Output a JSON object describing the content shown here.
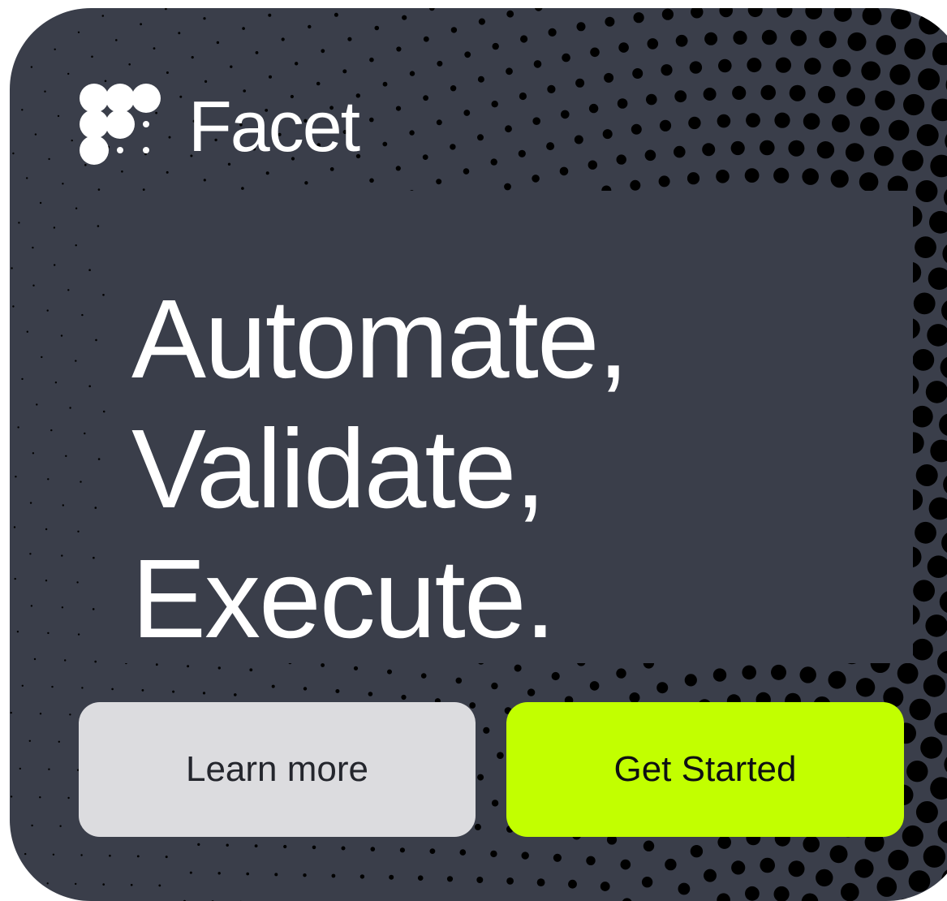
{
  "brand": {
    "name": "Facet",
    "logo_icon": "facet-dots-logo-icon"
  },
  "hero": {
    "lines": [
      "Automate,",
      "Validate,",
      "Execute."
    ]
  },
  "actions": {
    "learn_more": "Learn more",
    "get_started": "Get Started"
  },
  "colors": {
    "background": "#3a3e4a",
    "accent": "#c2ff00",
    "secondary_button": "#dcdcdf",
    "text": "#ffffff"
  }
}
